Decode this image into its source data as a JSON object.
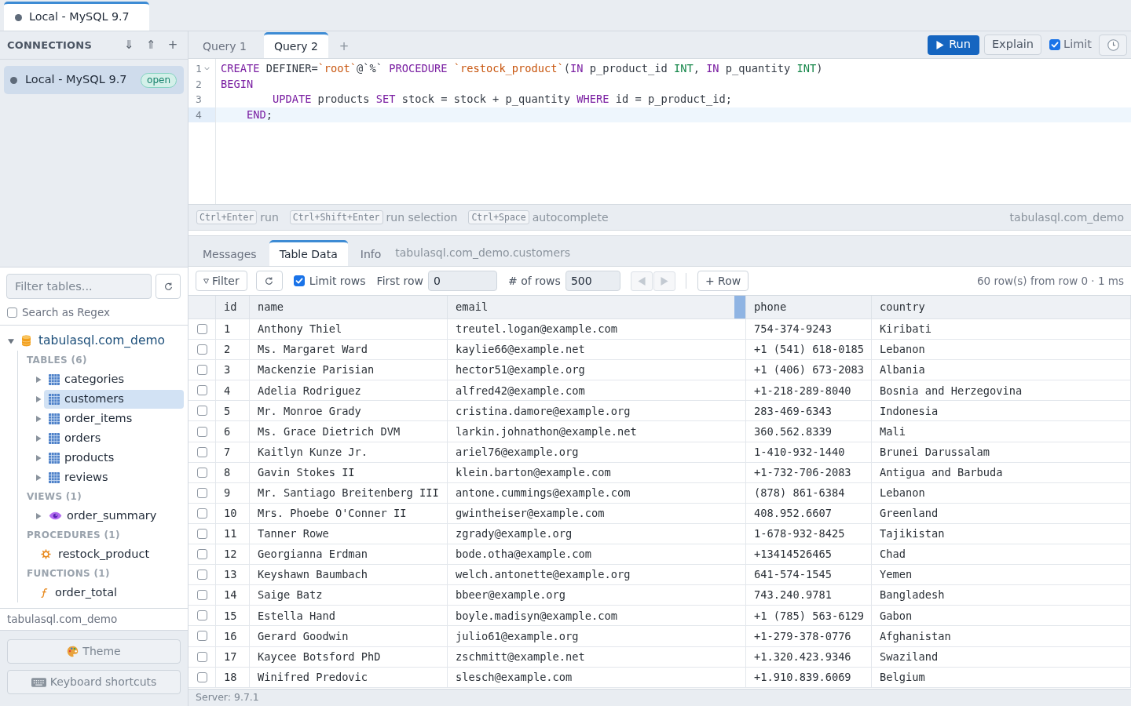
{
  "window_tabs": [
    {
      "label": "Local - MySQL 9.7",
      "selected": true
    }
  ],
  "connections_panel": {
    "title": "CONNECTIONS",
    "actions": [
      "⇓",
      "⇑",
      "+"
    ],
    "connections": [
      {
        "name": "Local - MySQL 9.7",
        "status": "open",
        "selected": true
      }
    ]
  },
  "object_browser": {
    "filter": {
      "placeholder": "Filter tables..."
    },
    "regex": {
      "label": "Search as Regex",
      "checked": false
    },
    "tree": [
      {
        "label": "tabulasql.com_demo",
        "kind": "database",
        "expanded": true,
        "children": [
          {
            "label": "TABLES (6)",
            "kind": "group",
            "children": [
              {
                "label": "categories",
                "kind": "table",
                "expanded": false,
                "selected": false
              },
              {
                "label": "customers",
                "kind": "table",
                "expanded": false,
                "selected": true
              },
              {
                "label": "order_items",
                "kind": "table",
                "expanded": false,
                "selected": false
              },
              {
                "label": "orders",
                "kind": "table",
                "expanded": false,
                "selected": false
              },
              {
                "label": "products",
                "kind": "table",
                "expanded": false,
                "selected": false
              },
              {
                "label": "reviews",
                "kind": "table",
                "expanded": false,
                "selected": false
              }
            ]
          },
          {
            "label": "VIEWS (1)",
            "kind": "group",
            "children": [
              {
                "label": "order_summary",
                "kind": "view",
                "expanded": false,
                "selected": false
              }
            ]
          },
          {
            "label": "PROCEDURES (1)",
            "kind": "group",
            "children": [
              {
                "label": "restock_product",
                "kind": "procedure",
                "selected": false
              }
            ]
          },
          {
            "label": "FUNCTIONS (1)",
            "kind": "group",
            "children": [
              {
                "label": "order_total",
                "kind": "function",
                "selected": false
              }
            ]
          }
        ]
      }
    ],
    "current_database": "tabulasql.com_demo"
  },
  "sidebar_buttons": [
    {
      "label": "Theme",
      "kind": "theme"
    },
    {
      "label": "Keyboard shortcuts",
      "kind": "shortcuts"
    }
  ],
  "query_tabs": {
    "tabs": [
      {
        "label": "Query 1",
        "selected": false
      },
      {
        "label": "Query 2",
        "selected": true
      }
    ],
    "add": "+"
  },
  "query_actions": {
    "run": "Run",
    "explain": "Explain",
    "limit": {
      "label": "Limit",
      "checked": true
    }
  },
  "editor": {
    "lines": [
      {
        "number": "1",
        "foldable": true,
        "active": false,
        "tokens": [
          {
            "text": "CREATE",
            "kind": "keyword"
          },
          {
            "text": " DEFINER=",
            "kind": "plain"
          },
          {
            "text": "`root`",
            "kind": "string"
          },
          {
            "text": "@`%` ",
            "kind": "plain"
          },
          {
            "text": "PROCEDURE",
            "kind": "keyword"
          },
          {
            "text": " `restock_product`",
            "kind": "string"
          },
          {
            "text": "(",
            "kind": "plain"
          },
          {
            "text": "IN",
            "kind": "keyword"
          },
          {
            "text": " p_product_id ",
            "kind": "plain"
          },
          {
            "text": "INT",
            "kind": "type"
          },
          {
            "text": ", ",
            "kind": "plain"
          },
          {
            "text": "IN",
            "kind": "keyword"
          },
          {
            "text": " p_quantity ",
            "kind": "plain"
          },
          {
            "text": "INT",
            "kind": "type"
          },
          {
            "text": ")",
            "kind": "plain"
          }
        ]
      },
      {
        "number": "2",
        "active": false,
        "tokens": [
          {
            "text": "BEGIN",
            "kind": "keyword"
          }
        ]
      },
      {
        "number": "3",
        "active": false,
        "tokens": [
          {
            "text": "        UPDATE",
            "kind": "keyword"
          },
          {
            "text": " products ",
            "kind": "plain"
          },
          {
            "text": "SET",
            "kind": "keyword"
          },
          {
            "text": " stock = stock + p_quantity ",
            "kind": "plain"
          },
          {
            "text": "WHERE",
            "kind": "keyword"
          },
          {
            "text": " id = p_product_id;",
            "kind": "plain"
          }
        ]
      },
      {
        "number": "4",
        "active": true,
        "tokens": [
          {
            "text": "    END",
            "kind": "keyword"
          },
          {
            "text": ";",
            "kind": "plain"
          }
        ]
      }
    ]
  },
  "hints": {
    "items": [
      {
        "keys": "Ctrl+Enter",
        "label": "run"
      },
      {
        "keys": "Ctrl+Shift+Enter",
        "label": "run selection"
      },
      {
        "keys": "Ctrl+Space",
        "label": "autocomplete"
      }
    ],
    "database": "tabulasql.com_demo"
  },
  "result_tabs": {
    "tabs": [
      {
        "label": "Messages",
        "selected": false
      },
      {
        "label": "Table Data",
        "selected": true
      },
      {
        "label": "Info",
        "selected": false
      }
    ],
    "source": "tabulasql.com_demo.customers"
  },
  "results_toolbar": {
    "filter": "Filter",
    "limit_rows": {
      "label": "Limit rows",
      "checked": true
    },
    "first_row": {
      "label": "First row",
      "value": "0"
    },
    "row_count": {
      "label": "# of rows",
      "value": "500"
    },
    "previous": {
      "disabled": true
    },
    "next": {
      "disabled": true
    },
    "add_row": "+ Row",
    "summary": "60 row(s) from row 0 · 1 ms"
  },
  "table": {
    "columns": [
      "id",
      "name",
      "email",
      "phone",
      "country"
    ],
    "rows": [
      {
        "checked": false,
        "cells": [
          "1",
          "Anthony Thiel",
          "treutel.logan@example.com",
          "754-374-9243",
          "Kiribati"
        ]
      },
      {
        "checked": false,
        "cells": [
          "2",
          "Ms. Margaret Ward",
          "kaylie66@example.net",
          "+1 (541) 618-0185",
          "Lebanon"
        ]
      },
      {
        "checked": false,
        "cells": [
          "3",
          "Mackenzie Parisian",
          "hector51@example.org",
          "+1 (406) 673-2083",
          "Albania"
        ]
      },
      {
        "checked": false,
        "cells": [
          "4",
          "Adelia Rodriguez",
          "alfred42@example.com",
          "+1-218-289-8040",
          "Bosnia and Herzegovina"
        ]
      },
      {
        "checked": false,
        "cells": [
          "5",
          "Mr. Monroe Grady",
          "cristina.damore@example.org",
          "283-469-6343",
          "Indonesia"
        ]
      },
      {
        "checked": false,
        "cells": [
          "6",
          "Ms. Grace Dietrich DVM",
          "larkin.johnathon@example.net",
          "360.562.8339",
          "Mali"
        ]
      },
      {
        "checked": false,
        "cells": [
          "7",
          "Kaitlyn Kunze Jr.",
          "ariel76@example.org",
          "1-410-932-1440",
          "Brunei Darussalam"
        ]
      },
      {
        "checked": false,
        "cells": [
          "8",
          "Gavin Stokes II",
          "klein.barton@example.com",
          "+1-732-706-2083",
          "Antigua and Barbuda"
        ]
      },
      {
        "checked": false,
        "cells": [
          "9",
          "Mr. Santiago Breitenberg III",
          "antone.cummings@example.com",
          "(878) 861-6384",
          "Lebanon"
        ]
      },
      {
        "checked": false,
        "cells": [
          "10",
          "Mrs. Phoebe O'Conner II",
          "gwintheiser@example.com",
          "408.952.6607",
          "Greenland"
        ]
      },
      {
        "checked": false,
        "cells": [
          "11",
          "Tanner Rowe",
          "zgrady@example.org",
          "1-678-932-8425",
          "Tajikistan"
        ]
      },
      {
        "checked": false,
        "cells": [
          "12",
          "Georgianna Erdman",
          "bode.otha@example.com",
          "+13414526465",
          "Chad"
        ]
      },
      {
        "checked": false,
        "cells": [
          "13",
          "Keyshawn Baumbach",
          "welch.antonette@example.org",
          "641-574-1545",
          "Yemen"
        ]
      },
      {
        "checked": false,
        "cells": [
          "14",
          "Saige Batz",
          "bbeer@example.org",
          "743.240.9781",
          "Bangladesh"
        ]
      },
      {
        "checked": false,
        "cells": [
          "15",
          "Estella Hand",
          "boyle.madisyn@example.com",
          "+1 (785) 563-6129",
          "Gabon"
        ]
      },
      {
        "checked": false,
        "cells": [
          "16",
          "Gerard Goodwin",
          "julio61@example.org",
          "+1-279-378-0776",
          "Afghanistan"
        ]
      },
      {
        "checked": false,
        "cells": [
          "17",
          "Kaycee Botsford PhD",
          "zschmitt@example.net",
          "+1.320.423.9346",
          "Swaziland"
        ]
      },
      {
        "checked": false,
        "cells": [
          "18",
          "Winifred Predovic",
          "slesch@example.com",
          "+1.910.839.6069",
          "Belgium"
        ]
      }
    ]
  },
  "status_bar": "Server: 9.7.1"
}
